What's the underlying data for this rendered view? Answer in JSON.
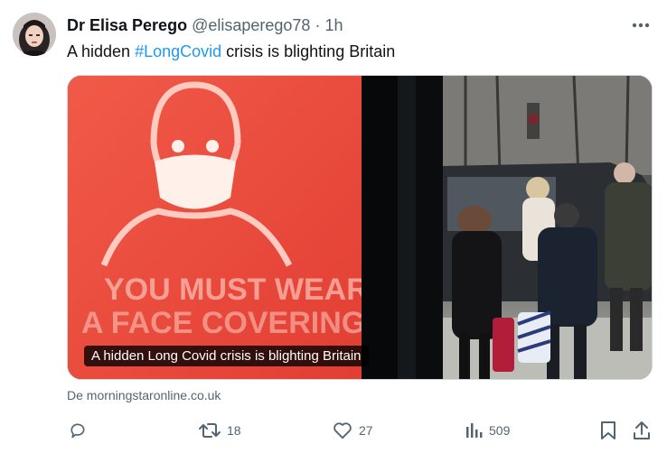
{
  "tweet": {
    "author_name": "Dr Elisa Perego",
    "author_handle": "@elisaperego78",
    "separator": "·",
    "time": "1h",
    "text_before": "A hidden ",
    "hashtag": "#LongCovid",
    "text_after": " crisis is blighting Britain"
  },
  "card": {
    "title": "A hidden Long Covid crisis is blighting Britain",
    "source": "De morningstaronline.co.uk",
    "poster_text_line1": "YOU MUST WEAR",
    "poster_text_line2": "A FACE COVERING ON"
  },
  "actions": {
    "reply_count": "",
    "retweet_count": "18",
    "like_count": "27",
    "views_count": "509"
  },
  "icons": [
    "more-icon",
    "reply-icon",
    "retweet-icon",
    "like-icon",
    "views-icon",
    "bookmark-icon",
    "share-icon"
  ],
  "colors": {
    "accent": "#1d9bf0",
    "text": "#0f1419",
    "muted": "#536471",
    "poster_red": "#ee4b3c"
  }
}
